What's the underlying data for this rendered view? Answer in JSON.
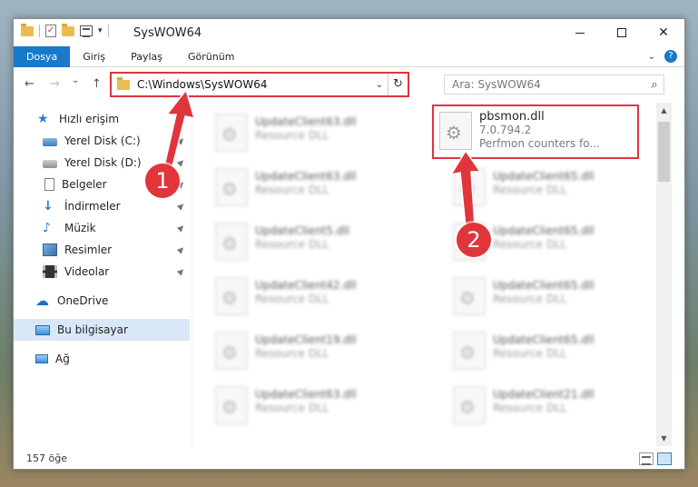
{
  "window": {
    "title": "SysWOW64",
    "controls": {
      "minimize": "",
      "maximize": "",
      "close": "✕"
    }
  },
  "ribbon": {
    "tabs": [
      "Dosya",
      "Giriş",
      "Paylaş",
      "Görünüm"
    ],
    "help": "?"
  },
  "nav": {
    "back": "←",
    "forward": "→",
    "recent": "⌄",
    "up": "↑",
    "address": "C:\\Windows\\SysWOW64",
    "refresh": "↻"
  },
  "search": {
    "placeholder": "Ara: SysWOW64"
  },
  "sidebar": {
    "items": [
      {
        "label": "Hızlı erişim",
        "icon": "star-icon"
      },
      {
        "label": "Yerel Disk (C:)",
        "icon": "disk-icon"
      },
      {
        "label": "Yerel Disk (D:)",
        "icon": "disk-icon"
      },
      {
        "label": "Belgeler",
        "icon": "document-icon"
      },
      {
        "label": "İndirmeler",
        "icon": "download-icon"
      },
      {
        "label": "Müzik",
        "icon": "music-icon"
      },
      {
        "label": "Resimler",
        "icon": "pictures-icon"
      },
      {
        "label": "Videolar",
        "icon": "video-icon"
      },
      {
        "label": "OneDrive",
        "icon": "cloud-icon"
      },
      {
        "label": "Bu bilgisayar",
        "icon": "computer-icon"
      },
      {
        "label": "Ağ",
        "icon": "network-icon"
      }
    ]
  },
  "files": {
    "left": [
      {
        "name": "UpdateClient63.dll",
        "type": "Resource DLL"
      },
      {
        "name": "UpdateClient63.dll",
        "type": "Resource DLL"
      },
      {
        "name": "UpdateClient5.dll",
        "type": "Resource DLL"
      },
      {
        "name": "UpdateClient42.dll",
        "type": "Resource DLL"
      },
      {
        "name": "UpdateClient19.dll",
        "type": "Resource DLL"
      },
      {
        "name": "UpdateClient63.dll",
        "type": "Resource DLL"
      }
    ],
    "highlighted": {
      "name": "pbsmon.dll",
      "version": "7.0.794.2",
      "description": "Perfmon counters fo..."
    },
    "right": [
      {
        "name": "UpdateClient65.dll",
        "type": "Resource DLL"
      },
      {
        "name": "UpdateClient65.dll",
        "type": "Resource DLL"
      },
      {
        "name": "UpdateClient65.dll",
        "type": "Resource DLL"
      },
      {
        "name": "UpdateClient65.dll",
        "type": "Resource DLL"
      },
      {
        "name": "UpdateClient21.dll",
        "type": "Resource DLL"
      }
    ]
  },
  "status": {
    "count": "157 öğe"
  },
  "annotations": {
    "callout1": "1",
    "callout2": "2",
    "color": "#e0353b"
  }
}
